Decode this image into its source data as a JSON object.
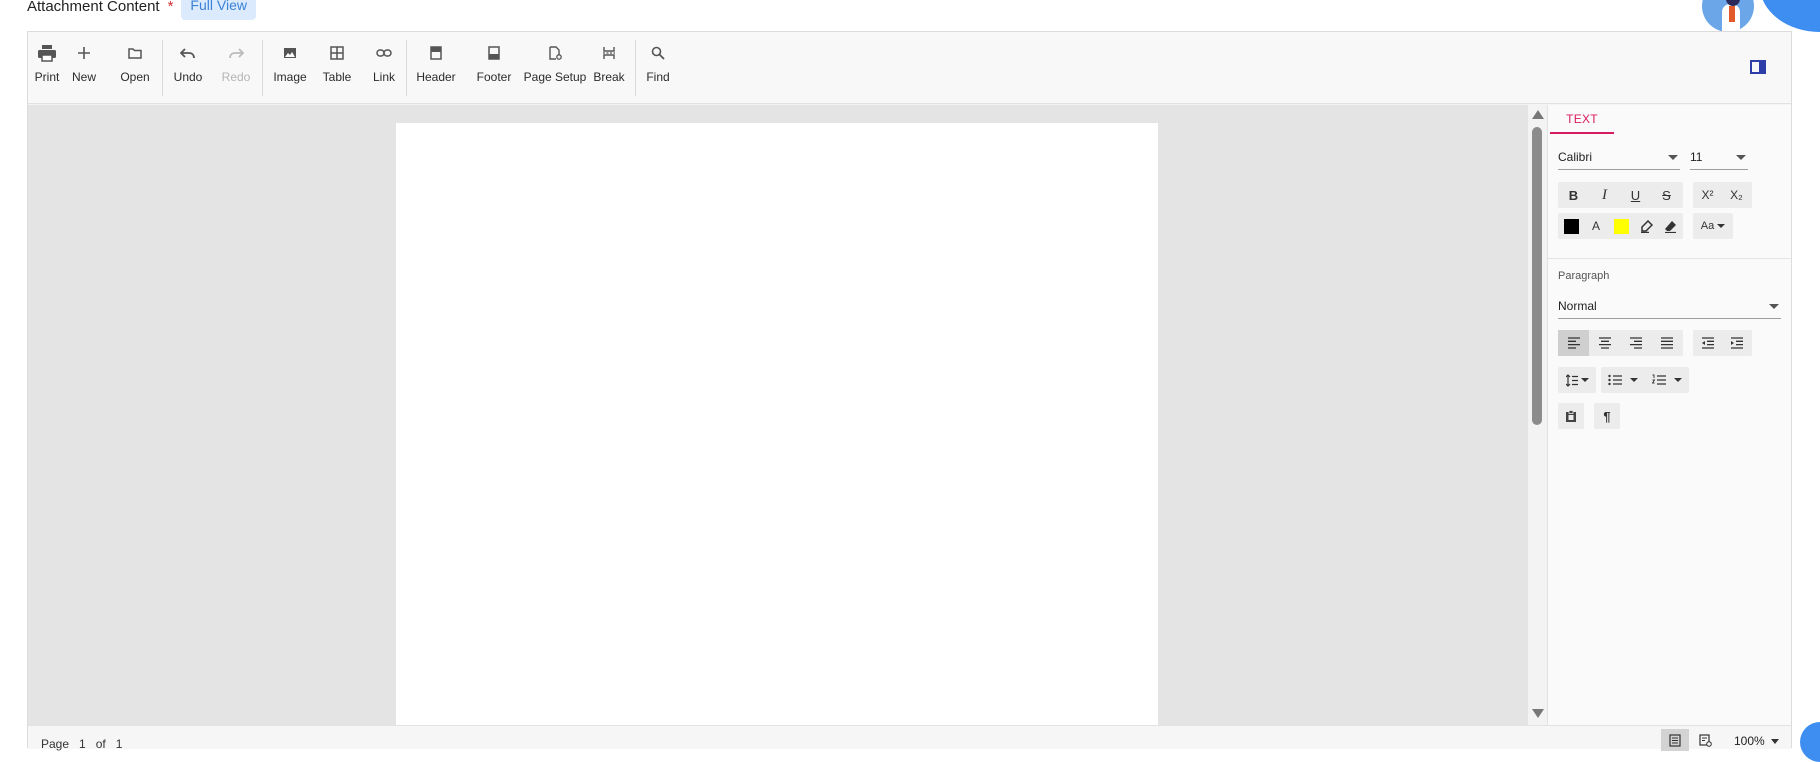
{
  "field": {
    "label": "Attachment Content",
    "required_mark": "*",
    "full_view": "Full View"
  },
  "toolbar": {
    "items": [
      {
        "label": "Print",
        "icon": "print-icon"
      },
      {
        "label": "New",
        "icon": "plus-icon"
      },
      {
        "label": "Open",
        "icon": "folder-icon"
      },
      {
        "label": "Undo",
        "icon": "undo-icon"
      },
      {
        "label": "Redo",
        "icon": "redo-icon",
        "disabled": true
      },
      {
        "label": "Image",
        "icon": "image-icon"
      },
      {
        "label": "Table",
        "icon": "table-icon"
      },
      {
        "label": "Link",
        "icon": "link-icon"
      },
      {
        "label": "Header",
        "icon": "header-icon"
      },
      {
        "label": "Footer",
        "icon": "footer-icon"
      },
      {
        "label": "Page Setup",
        "icon": "page-setup-icon"
      },
      {
        "label": "Break",
        "icon": "break-icon"
      },
      {
        "label": "Find",
        "icon": "search-icon"
      }
    ]
  },
  "properties": {
    "tab": "TEXT",
    "font_family": "Calibri",
    "font_size": "11",
    "paragraph_label": "Paragraph",
    "paragraph_style": "Normal",
    "font_color": "#000000",
    "highlight_color": "#ffff00",
    "glyphs": {
      "bold": "B",
      "italic": "I",
      "underline": "U",
      "strike": "S",
      "superscript": "X²",
      "subscript": "X₂",
      "font_color": "A",
      "change_case": "Aa",
      "pilcrow": "¶"
    }
  },
  "status": {
    "page_label": "Page",
    "page_current": "1",
    "of_label": "of",
    "page_total": "1",
    "zoom": "100%"
  },
  "colors": {
    "accent": "#d81b60",
    "primary_blue": "#3d8ef0"
  }
}
